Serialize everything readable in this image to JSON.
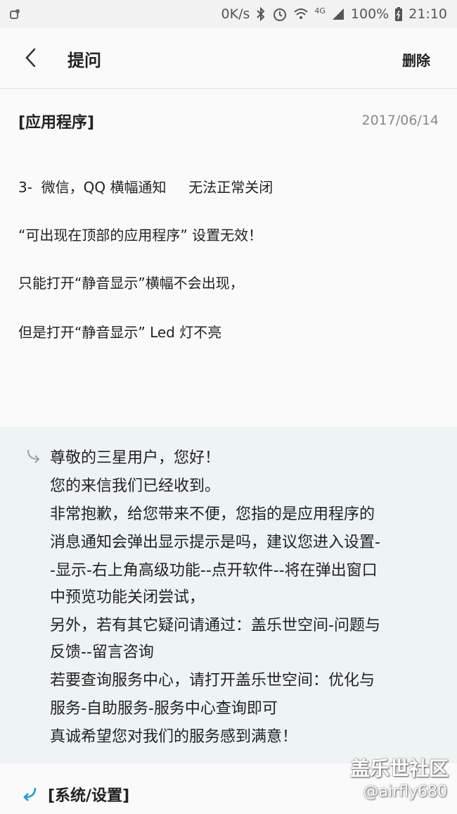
{
  "status_bar": {
    "speed": "0K/s",
    "network": "4G",
    "battery": "100%",
    "time": "21:10",
    "icons": [
      "notification-icon",
      "bluetooth-icon",
      "alarm-icon",
      "wifi-icon",
      "signal-icon",
      "battery-icon"
    ]
  },
  "app_bar": {
    "title": "提问",
    "delete_label": "删除",
    "back_icon": "chevron-left-icon"
  },
  "question": {
    "category": "[应用程序]",
    "date": "2017/06/14",
    "lines": [
      "3-  微信，QQ 横幅通知     无法正常关闭",
      "“可出现在顶部的应用程序” 设置无效！",
      "只能打开“静音显示”横幅不会出现，",
      "但是打开“静音显示” Led 灯不亮"
    ]
  },
  "reply": {
    "icon": "reply-arrow-icon",
    "lines": [
      "尊敬的三星用户，您好！",
      "您的来信我们已经收到。",
      "非常抱歉，给您带来不便，您指的是应用程序的",
      "消息通知会弹出显示提示是吗，建议您进入设置-",
      "-显示-右上角高级功能--点开软件--将在弹出窗口",
      "中预览功能关闭尝试，",
      "另外，若有其它疑问请通过：盖乐世空间-问题与",
      "反馈--留言咨询",
      "若要查询服务中心，请打开盖乐世空间：优化与",
      "服务-自助服务-服务中心查询即可",
      "真诚希望您对我们的服务感到满意！"
    ]
  },
  "next_item": {
    "icon": "return-arrow-icon",
    "category": "[系统/设置]"
  },
  "watermark": {
    "title": "盖乐世社区",
    "user": "@airfly680"
  },
  "colors": {
    "reply_bg": "#eef3f4",
    "accent": "#1a9bd7"
  }
}
